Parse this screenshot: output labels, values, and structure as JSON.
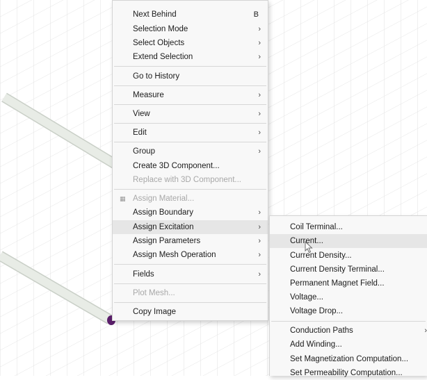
{
  "colors": {
    "menu_bg": "#f8f8f8",
    "highlight": "#e6e6e6",
    "disabled_text": "#a8a8a8",
    "grid_line": "#e3e3e3",
    "wire": "#e8ece6",
    "terminal": "#5b1f6b"
  },
  "context_menu": {
    "items": [
      {
        "label": "Next Behind",
        "accelerator": "B"
      },
      {
        "label": "Selection Mode",
        "arrow": "›"
      },
      {
        "label": "Select Objects",
        "arrow": "›"
      },
      {
        "label": "Extend Selection",
        "arrow": "›"
      },
      {
        "label": "Go to History"
      },
      {
        "label": "Measure",
        "arrow": "›"
      },
      {
        "label": "View",
        "arrow": "›"
      },
      {
        "label": "Edit",
        "arrow": "›"
      },
      {
        "label": "Group",
        "arrow": "›"
      },
      {
        "label": "Create 3D Component..."
      },
      {
        "label": "Replace with 3D Component..."
      },
      {
        "label": "Assign Material...",
        "icon": "material-icon"
      },
      {
        "label": "Assign Boundary",
        "arrow": "›"
      },
      {
        "label": "Assign Excitation",
        "arrow": "›"
      },
      {
        "label": "Assign Parameters",
        "arrow": "›"
      },
      {
        "label": "Assign Mesh Operation",
        "arrow": "›"
      },
      {
        "label": "Fields",
        "arrow": "›"
      },
      {
        "label": "Plot Mesh..."
      },
      {
        "label": "Copy Image"
      }
    ]
  },
  "excitation_submenu": {
    "items": [
      {
        "label": "Coil Terminal..."
      },
      {
        "label": "Current..."
      },
      {
        "label": "Current Density..."
      },
      {
        "label": "Current Density Terminal..."
      },
      {
        "label": "Permanent Magnet Field..."
      },
      {
        "label": "Voltage..."
      },
      {
        "label": "Voltage Drop..."
      },
      {
        "label": "Conduction Paths",
        "arrow": "›"
      },
      {
        "label": "Add Winding..."
      },
      {
        "label": "Set Magnetization Computation..."
      },
      {
        "label": "Set Permeability Computation..."
      }
    ]
  }
}
